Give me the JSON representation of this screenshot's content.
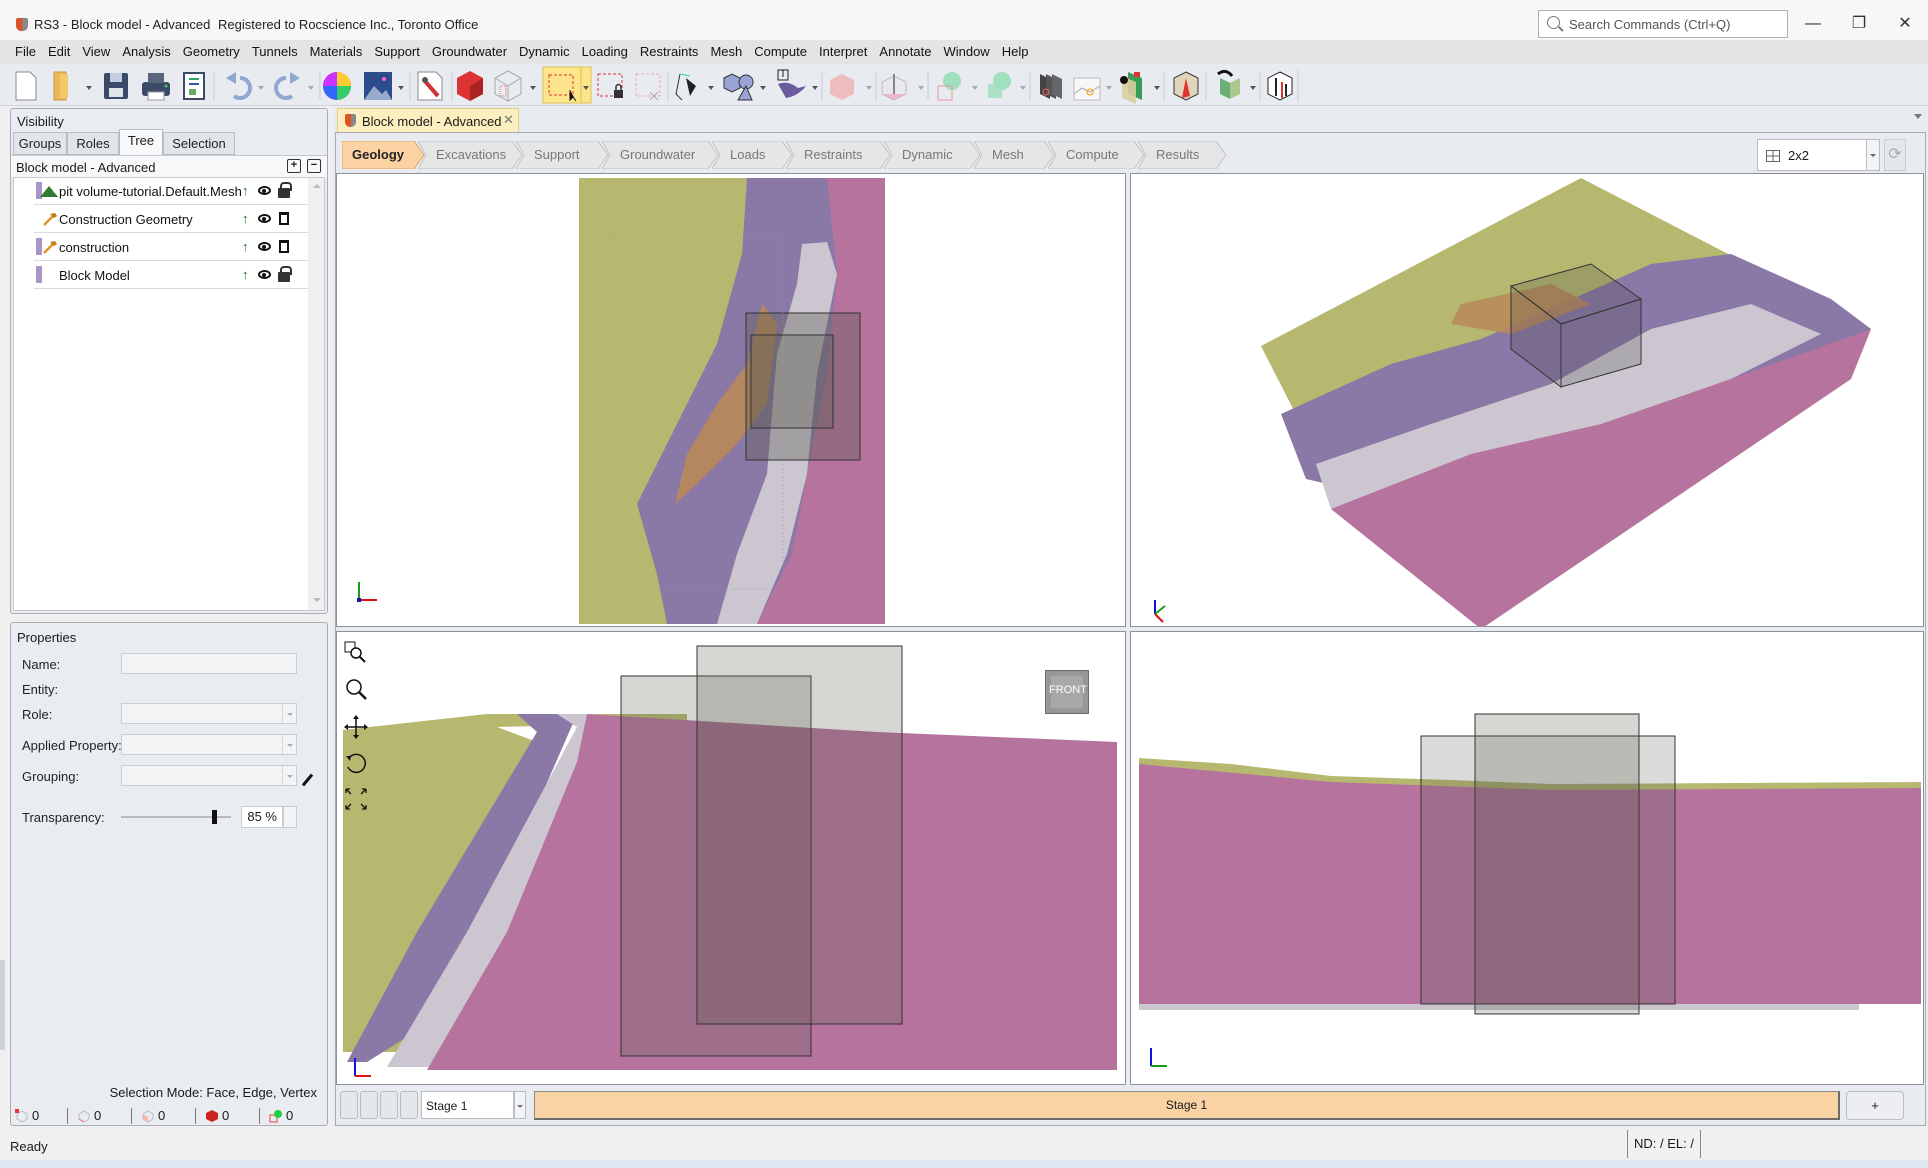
{
  "window": {
    "title": "RS3 - Block model - Advanced",
    "registration": "Registered to Rocscience Inc., Toronto Office",
    "search_placeholder": "Search Commands (Ctrl+Q)",
    "controls": {
      "minimize": "—",
      "restore": "❐",
      "close": "✕"
    }
  },
  "menu": [
    "File",
    "Edit",
    "View",
    "Analysis",
    "Geometry",
    "Tunnels",
    "Materials",
    "Support",
    "Groundwater",
    "Dynamic",
    "Loading",
    "Restraints",
    "Mesh",
    "Compute",
    "Interpret",
    "Annotate",
    "Window",
    "Help"
  ],
  "toolbar": {
    "icons": [
      "new-file-icon",
      "open-folder-icon",
      "save-icon",
      "print-icon",
      "report-icon",
      "undo-icon",
      "redo-icon",
      "color-wheel-icon",
      "image-icon",
      "edit-geometry-icon",
      "solid-red-icon",
      "wire-box-icon",
      "box-select-icon",
      "lock-selection-icon",
      "clear-selection-icon",
      "pen-tool-icon",
      "shapes-icon",
      "import-surface-icon",
      "move-solid-icon",
      "extrude-icon",
      "boolean-union-icon",
      "boolean-intersect-icon",
      "layers-icon",
      "surface-profile-icon",
      "view-section-icon",
      "cut-solid-icon",
      "paint-bucket-icon",
      "dimension-icon"
    ]
  },
  "visibility": {
    "title": "Visibility",
    "tabs": [
      "Groups",
      "Roles",
      "Tree",
      "Selection"
    ],
    "active_tab": "Tree",
    "tree_header": "Block model - Advanced",
    "items": [
      {
        "label": "pit volume-tutorial.Default.Mesh",
        "icon": "mesh-mountain-icon",
        "color": "#a996c8",
        "action": "lock"
      },
      {
        "label": "Construction Geometry",
        "icon": "hammer-icon",
        "color": "",
        "action": "delete"
      },
      {
        "label": "construction",
        "icon": "hammer-icon",
        "color": "#a996c8",
        "action": "delete"
      },
      {
        "label": "Block Model",
        "icon": "",
        "color": "#a996c8",
        "action": "lock"
      }
    ]
  },
  "properties": {
    "title": "Properties",
    "name_label": "Name:",
    "name_value": "",
    "entity_label": "Entity:",
    "role_label": "Role:",
    "applied_label": "Applied Property:",
    "grouping_label": "Grouping:",
    "transparency_label": "Transparency:",
    "transparency_value": "85 %",
    "transparency_fraction": 0.85,
    "selection_mode": "Selection Mode: Face, Edge, Vertex",
    "counters": [
      {
        "icon": "vertex-select-icon",
        "value": "0"
      },
      {
        "icon": "edge-select-icon",
        "value": "0"
      },
      {
        "icon": "face-select-icon",
        "value": "0"
      },
      {
        "icon": "solid-select-icon",
        "value": "0"
      },
      {
        "icon": "entity-select-icon",
        "value": "0"
      }
    ]
  },
  "document": {
    "tab_title": "Block model - Advanced",
    "workflow_tabs": [
      "Geology",
      "Excavations",
      "Support",
      "Groundwater",
      "Loads",
      "Restraints",
      "Dynamic",
      "Mesh",
      "Compute",
      "Results"
    ],
    "active_workflow": "Geology",
    "layout": "2x2",
    "front_cube_label": "FRONT",
    "colors": {
      "olive": "#b6b86f",
      "purple": "#8a78a6",
      "grey": "#c8c4cc",
      "pink": "#b5739d",
      "orange": "#b88a5a",
      "box": "#7a7a6a"
    }
  },
  "stages": {
    "selected": "Stage 1",
    "timeline_label": "Stage 1",
    "add_label": "+"
  },
  "status": {
    "left": "Ready",
    "right": "ND: /  EL: /"
  }
}
